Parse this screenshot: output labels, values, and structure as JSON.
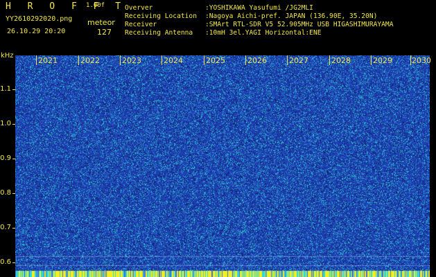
{
  "header": {
    "title": "H R O F F T",
    "version": "1.00f",
    "filename": "YY2610292020.png",
    "detection_type": "meteor",
    "timestamp": "26.10.29 20:20",
    "count": "127"
  },
  "metadata": [
    {
      "label": "Overver",
      "value": ":YOSHIKAWA Yasufumi /JG2MLI"
    },
    {
      "label": "Receiving Location",
      "value": ":Nagoya Aichi-pref. JAPAN (136.90E, 35.20N)"
    },
    {
      "label": "Receiver",
      "value": ":SMArt RTL-SDR V5 52.905MHz USB HIGASHIMURAYAMA"
    },
    {
      "label": "Receiving Antenna",
      "value": ":10mH 3el.YAGI Horizontal:ENE"
    }
  ],
  "spectrogram": {
    "unit_label": "kHz",
    "y_ticks": [
      "1.1",
      "1.0",
      "0.9",
      "0.8",
      "0.7",
      "0.6"
    ],
    "x_labels": [
      "2021",
      "2022",
      "2023",
      "2024",
      "2025",
      "2026",
      "2027",
      "2028",
      "2029",
      "2030"
    ]
  },
  "colors": {
    "text": "#f4e84a",
    "background": "#000000",
    "plot_background": "#1e3ea8",
    "noise_cyan": "#2fd6d6",
    "bottom_band": "#f2ee22"
  }
}
